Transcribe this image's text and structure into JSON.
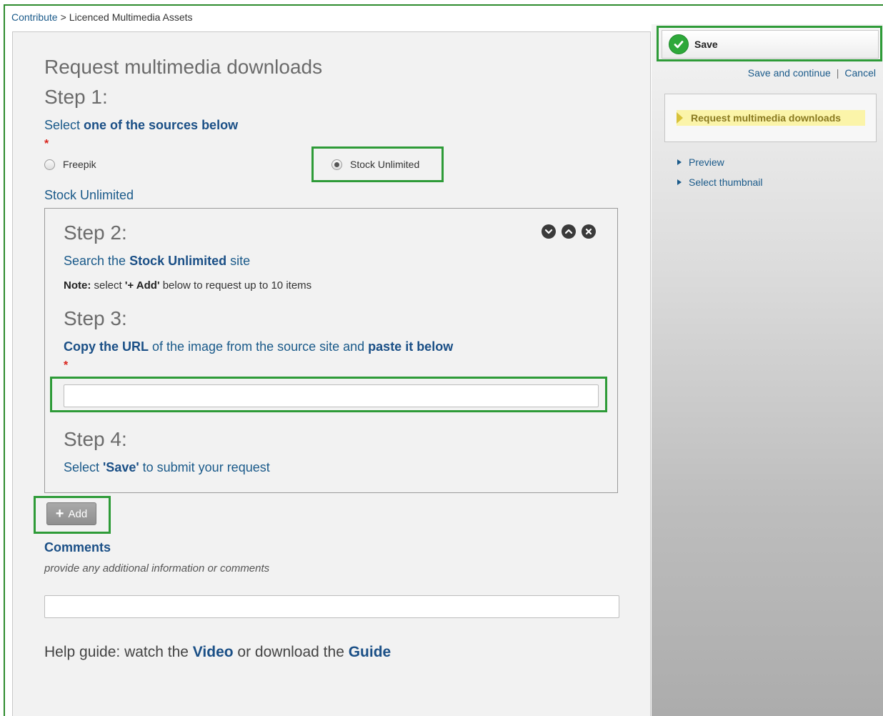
{
  "breadcrumb": {
    "link": "Contribute",
    "separator": ">",
    "current": "Licenced Multimedia Assets"
  },
  "form": {
    "title": "Request multimedia downloads",
    "step1": {
      "heading": "Step 1:",
      "instruction_pre": "Select ",
      "instruction_bold": "one of the sources below",
      "required_mark": "*",
      "options": [
        {
          "label": "Freepik",
          "checked": false
        },
        {
          "label": "Stock Unlimited",
          "checked": true
        }
      ],
      "selected_source_label": "Stock Unlimited"
    },
    "step2": {
      "heading": "Step 2:",
      "instruction_pre": "Search the ",
      "instruction_bold": "Stock Unlimited",
      "instruction_post": " site",
      "note_bold": "Note:",
      "note_pre": " select ",
      "note_add": "'+ Add'",
      "note_post": " below to request up to 10 items"
    },
    "step3": {
      "heading": "Step 3:",
      "bold1": "Copy the URL",
      "mid": " of the image from the source site and ",
      "bold2": "paste it below",
      "required_mark": "*",
      "url_value": "",
      "url_placeholder": ""
    },
    "step4": {
      "heading": "Step 4:",
      "pre": "Select ",
      "bold": "'Save'",
      "post": " to submit your request"
    },
    "add_button": {
      "icon": "plus-icon",
      "label": "Add"
    },
    "comments": {
      "label": "Comments",
      "hint": "provide any additional information or comments",
      "value": ""
    },
    "help": {
      "pre": "Help guide: watch the ",
      "video": "Video",
      "mid": " or download the ",
      "guide": "Guide"
    }
  },
  "sidebar": {
    "save_label": "Save",
    "save_and_continue": "Save and continue",
    "pipe": "|",
    "cancel": "Cancel",
    "current_step": "Request multimedia downloads",
    "items": [
      {
        "label": "Preview"
      },
      {
        "label": "Select thumbnail"
      }
    ]
  },
  "colors": {
    "highlight": "#2e9b38",
    "link": "#1a5a8a",
    "save_check": "#2ea83a",
    "current_step_bg": "#fbf4a9"
  }
}
